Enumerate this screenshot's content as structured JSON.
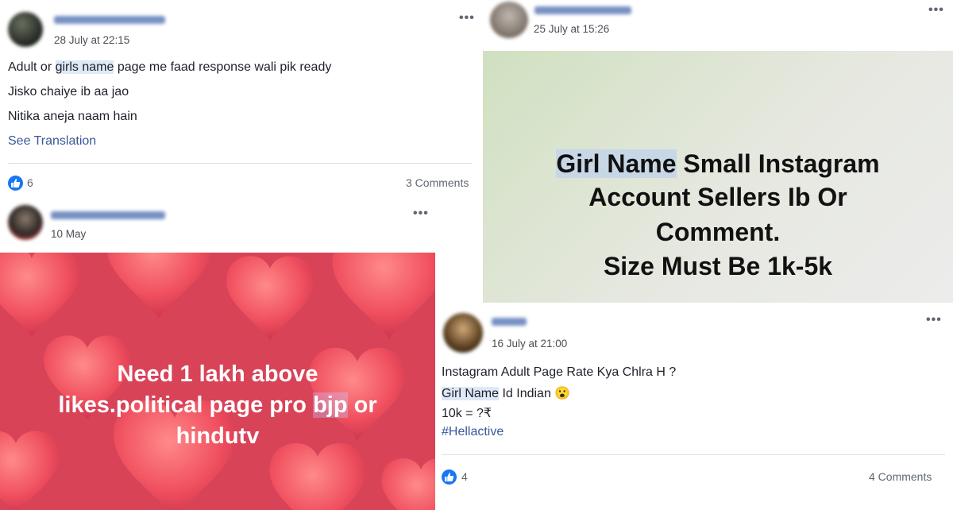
{
  "post1": {
    "timestamp": "28 July at 22:15",
    "lines": {
      "l1_before": "Adult or ",
      "l1_highlight": "girls name",
      "l1_after": " page me faad response wali pik ready",
      "l2": "Jisko chaiye ib aa jao",
      "l3": "Nitika aneja naam hain"
    },
    "see_translation": "See Translation",
    "likes": "6",
    "comments": "3 Comments"
  },
  "post2": {
    "timestamp": "10 May",
    "image_text": {
      "line1": "Need 1 lakh above",
      "line2_before": "likes.political page pro ",
      "line2_highlight": "bjp",
      "line2_after": " or",
      "line3": "hindutv"
    }
  },
  "post3": {
    "timestamp": "25 July at 15:26",
    "image_text": {
      "line1_highlight": "Girl Name",
      "line1_after": " Small Instagram",
      "line2": "Account Sellers Ib Or",
      "line3": "Comment.",
      "line4": "Size Must Be 1k-5k"
    }
  },
  "post4": {
    "timestamp": "16 July at 21:00",
    "lines": {
      "l1": "Instagram Adult Page Rate Kya Chlra H ?",
      "l2_highlight": "Girl Name",
      "l2_after": " Id Indian 😮",
      "l3": "10k = ?₹",
      "hashtag": "#Hellactive"
    },
    "likes": "4",
    "comments": "4 Comments"
  },
  "colors": {
    "link": "#385898",
    "like_blue": "#1877f2",
    "highlight": "#dfe8f6",
    "heart_bg": "#e84f63"
  },
  "icons": {
    "more": "more-options-icon",
    "like": "like-thumb-icon"
  },
  "ui": {
    "more_glyph": "•••"
  }
}
